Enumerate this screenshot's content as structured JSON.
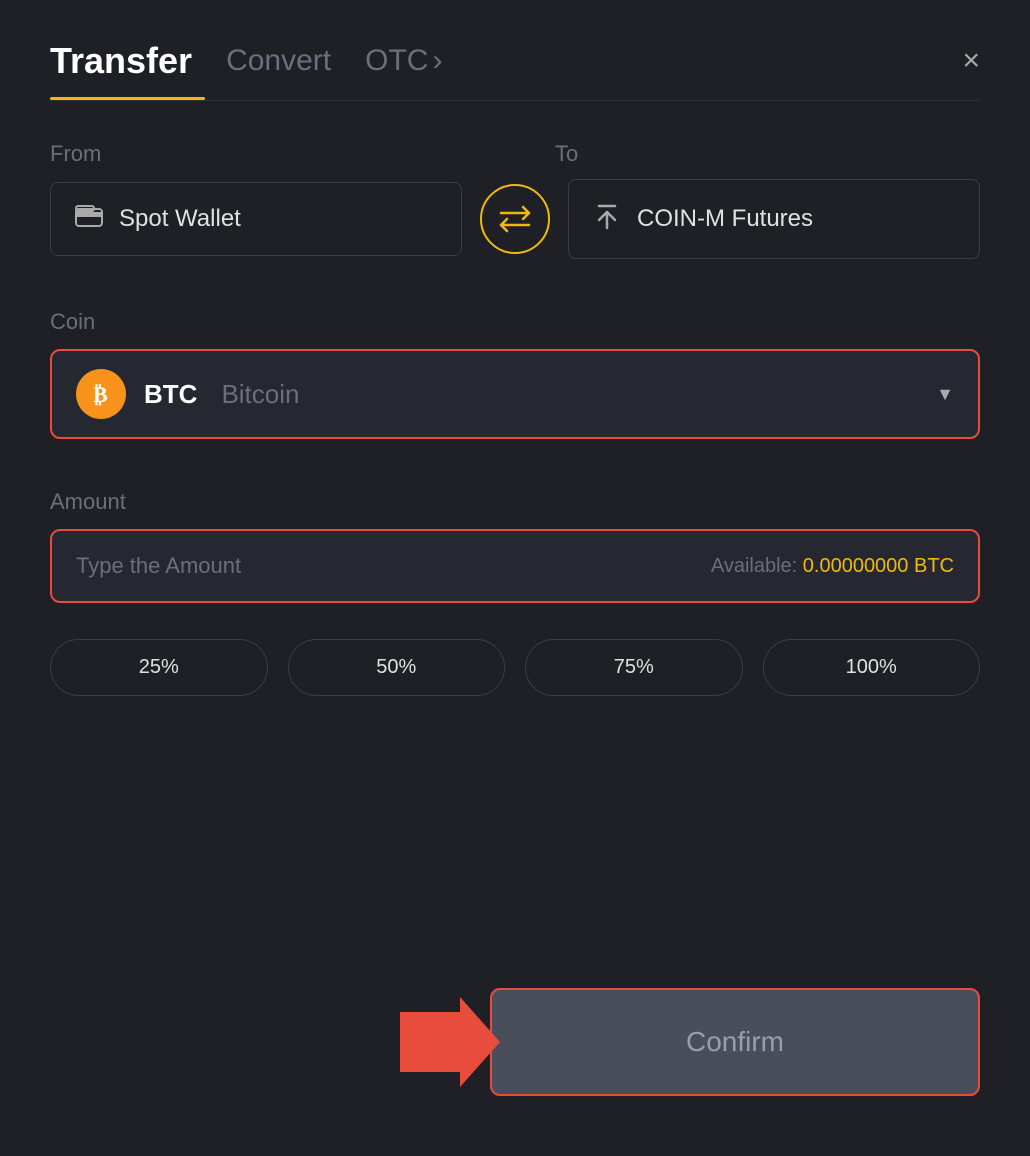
{
  "header": {
    "title": "Transfer",
    "tab_convert": "Convert",
    "tab_otc": "OTC",
    "tab_otc_arrow": "›",
    "close_label": "×"
  },
  "from_section": {
    "label": "From",
    "wallet_icon": "▬",
    "wallet_name": "Spot Wallet"
  },
  "to_section": {
    "label": "To",
    "wallet_icon": "↑",
    "wallet_name": "COIN-M Futures"
  },
  "swap": {
    "icon": "⇄"
  },
  "coin_section": {
    "label": "Coin",
    "coin_symbol": "BTC",
    "coin_name": "Bitcoin",
    "chevron": "▼"
  },
  "amount_section": {
    "label": "Amount",
    "placeholder": "Type the Amount",
    "available_label": "Available:",
    "available_amount": "0.00000000 BTC"
  },
  "percent_buttons": [
    "25%",
    "50%",
    "75%",
    "100%"
  ],
  "confirm_button": {
    "label": "Confirm"
  }
}
